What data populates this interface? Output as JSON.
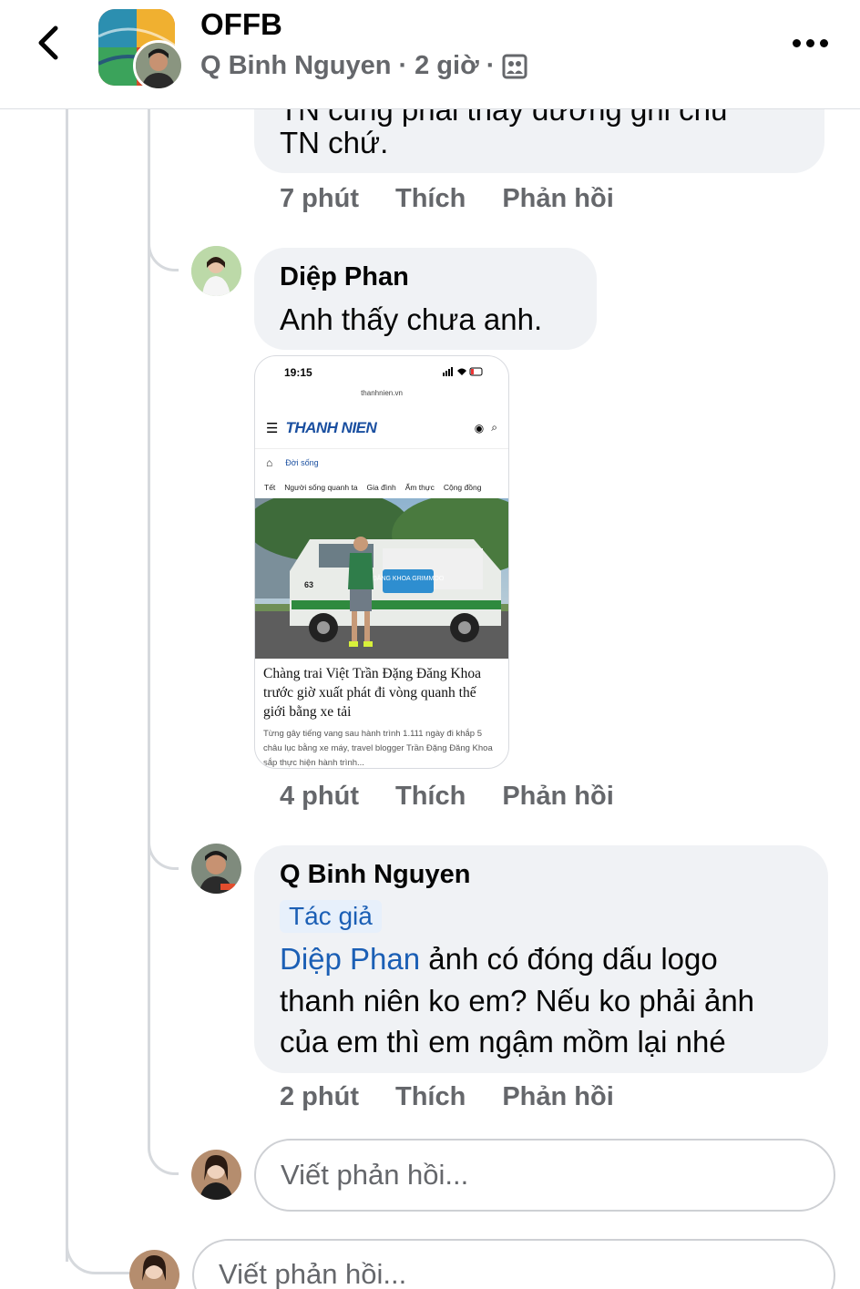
{
  "header": {
    "group_name": "OFFB",
    "author": "Q Binh Nguyen",
    "time": "2 giờ",
    "separator": "·",
    "privacy_icon": "group-members-icon",
    "back_icon": "chevron-left-icon",
    "more_icon": "more-horizontal-icon"
  },
  "comments": [
    {
      "name": "",
      "text_cut": "TN cũng phải thấy đường ghi chú",
      "text": "TN chứ.",
      "time": "7 phút",
      "like": "Thích",
      "reply": "Phản hồi"
    },
    {
      "name": "Diệp Phan",
      "text": "Anh thấy chưa anh.",
      "time": "4 phút",
      "like": "Thích",
      "reply": "Phản hồi",
      "attachment": {
        "status_time": "19:15",
        "url": "thanhnien.vn",
        "logo": "THANH NIEN",
        "section": "Đời sống",
        "categories": [
          "Tết",
          "Người sống quanh ta",
          "Gia đình",
          "Ẩm thực",
          "Cộng đồng"
        ],
        "headline": "Chàng trai Việt Trần Đặng Đăng Khoa trước giờ xuất phát đi vòng quanh thế giới bằng xe tải",
        "summary": "Từng gây tiếng vang sau hành trình 1.111 ngày đi khắp 5 châu lục bằng xe máy, travel blogger Trần Đặng Đăng Khoa sắp thực hiện hành trình...",
        "van_sign": "ĐĂNG KHOA GRIMMOO",
        "van_plate": "63"
      }
    },
    {
      "name": "Q Binh Nguyen",
      "badge": "Tác giả",
      "mention": "Diệp Phan",
      "text_line1": " ảnh có đóng dấu logo",
      "text_line2": "thanh niên ko em? Nếu ko phải ảnh",
      "text_line3": "của em thì em ngậm mồm lại nhé",
      "time": "2 phút",
      "like": "Thích",
      "reply": "Phản hồi"
    }
  ],
  "reply_box": {
    "placeholder": "Viết phản hồi..."
  },
  "reply_box_main": {
    "placeholder": "Viết phản hồi..."
  }
}
